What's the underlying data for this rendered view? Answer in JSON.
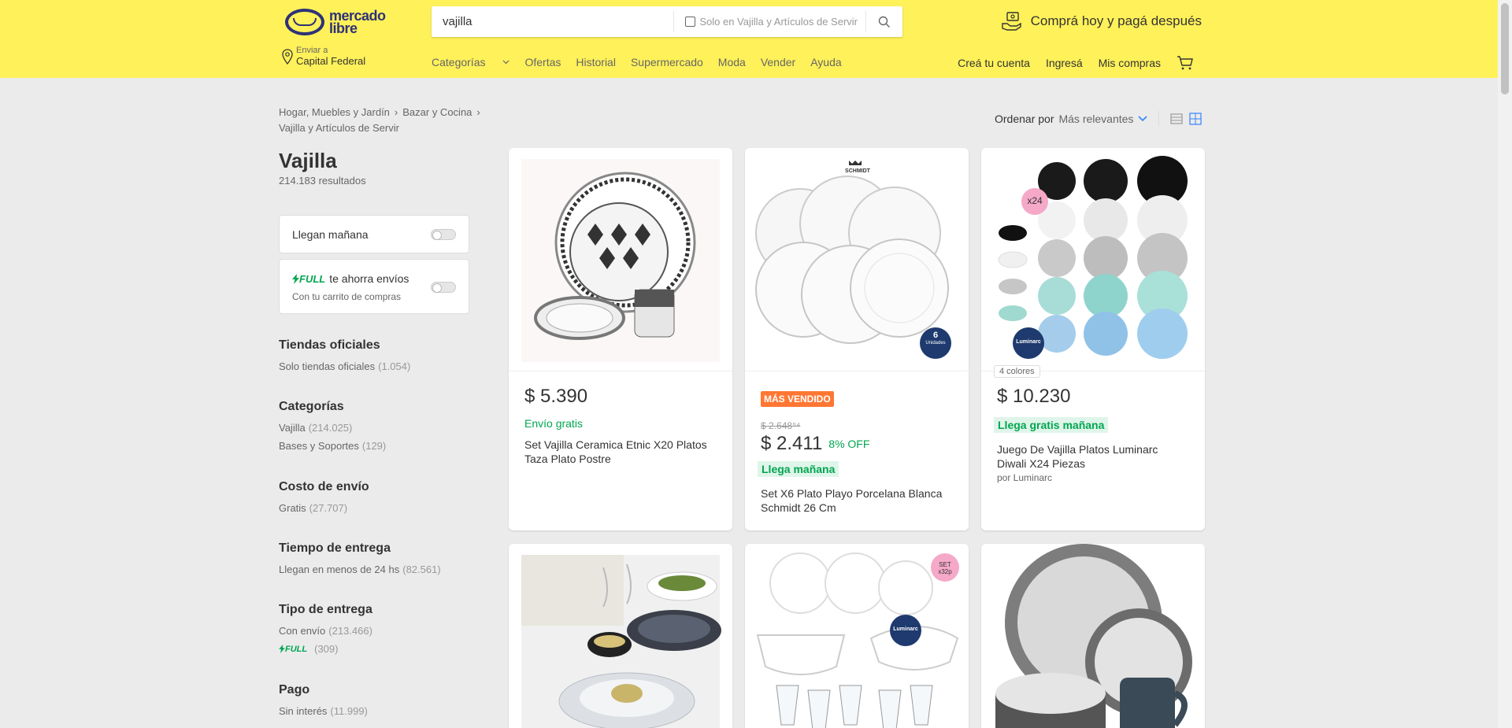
{
  "header": {
    "logo_line1": "mercado",
    "logo_line2": "libre",
    "search_value": "vajilla",
    "search_checkbox_label": "Solo en Vajilla y Artículos de Servir",
    "promo": "Comprá hoy y pagá después",
    "location_label": "Enviar a",
    "location_city": "Capital Federal",
    "nav": [
      "Categorías",
      "Ofertas",
      "Historial",
      "Supermercado",
      "Moda",
      "Vender",
      "Ayuda"
    ],
    "user_nav": [
      "Creá tu cuenta",
      "Ingresá",
      "Mis compras"
    ]
  },
  "breadcrumb": [
    "Hogar, Muebles y Jardín",
    "Bazar y Cocina",
    "Vajilla y Artículos de Servir"
  ],
  "sort": {
    "label": "Ordenar por",
    "value": "Más relevantes"
  },
  "page": {
    "title": "Vajilla",
    "results": "214.183 resultados"
  },
  "quick_filters": {
    "tomorrow": "Llegan mañana",
    "full_label": "FULL",
    "full_text": "te ahorra envíos",
    "full_sub": "Con tu carrito de compras"
  },
  "filters": [
    {
      "title": "Tiendas oficiales",
      "items": [
        {
          "label": "Solo tiendas oficiales",
          "count": "(1.054)"
        }
      ]
    },
    {
      "title": "Categorías",
      "items": [
        {
          "label": "Vajilla",
          "count": "(214.025)"
        },
        {
          "label": "Bases y Soportes",
          "count": "(129)"
        }
      ]
    },
    {
      "title": "Costo de envío",
      "items": [
        {
          "label": "Gratis",
          "count": "(27.707)"
        }
      ]
    },
    {
      "title": "Tiempo de entrega",
      "items": [
        {
          "label": "Llegan en menos de 24 hs",
          "count": "(82.561)"
        }
      ]
    },
    {
      "title": "Tipo de entrega",
      "items": [
        {
          "label": "Con envío",
          "count": "(213.466)"
        },
        {
          "label": "FULL",
          "count": "(309)"
        }
      ]
    },
    {
      "title": "Pago",
      "items": [
        {
          "label": "Sin interés",
          "count": "(11.999)"
        }
      ]
    }
  ],
  "products": [
    {
      "price": "$ 5.390",
      "shipping": "Envío gratis",
      "title": "Set Vajilla Ceramica Etnic X20 Platos Taza Plato Postre"
    },
    {
      "badge": "MÁS VENDIDO",
      "old_price": "$ 2.648⁹⁴",
      "price": "$ 2.411",
      "off": "8% OFF",
      "shipping": "Llega mañana",
      "title": "Set X6 Plato Playo Porcelana Blanca Schmidt 26 Cm",
      "img_brand": "SCHMIDT",
      "img_units_num": "6",
      "img_units": "Unidades"
    },
    {
      "colors": "4 colores",
      "price": "$ 10.230",
      "shipping": "Llega gratis mañana",
      "title": "Juego De Vajilla Platos Luminarc Diwali X24 Piezas",
      "brand": "por Luminarc",
      "img_qty": "x24",
      "img_brand": "Luminarc"
    },
    {
      "title": ""
    },
    {
      "img_qty": "SET x32p",
      "img_brand": "Luminarc"
    },
    {
      "title": ""
    }
  ],
  "colors": {
    "header_bg": "#fff159",
    "green": "#00a650",
    "orange": "#ff7733",
    "blue": "#3483fa"
  }
}
